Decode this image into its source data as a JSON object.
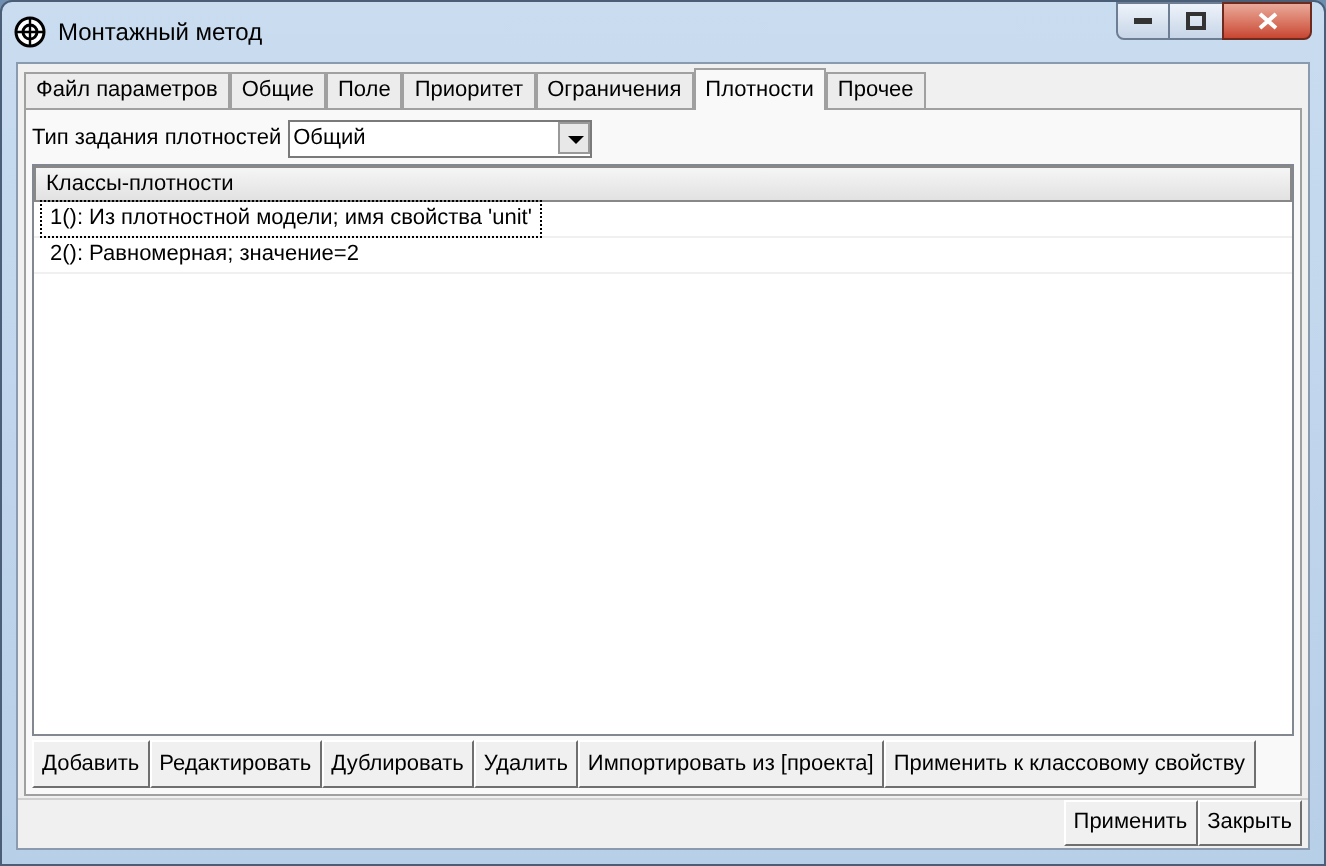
{
  "window": {
    "title": "Монтажный метод"
  },
  "tabs": [
    {
      "label": "Файл параметров",
      "selected": false
    },
    {
      "label": "Общие",
      "selected": false
    },
    {
      "label": "Поле",
      "selected": false
    },
    {
      "label": "Приоритет",
      "selected": false
    },
    {
      "label": "Ограничения",
      "selected": false
    },
    {
      "label": "Плотности",
      "selected": true
    },
    {
      "label": "Прочее",
      "selected": false
    }
  ],
  "density_type": {
    "label": "Тип задания плотностей",
    "value": "Общий"
  },
  "table": {
    "columns": [
      "Классы-плотности"
    ],
    "rows": [
      {
        "text": "1(): Из плотностной модели; имя свойства 'unit'",
        "selected": true
      },
      {
        "text": "2(): Равномерная; значение=2",
        "selected": false
      }
    ]
  },
  "buttons": [
    "Добавить",
    "Редактировать",
    "Дублировать",
    "Удалить",
    "Импортировать из [проекта]",
    "Применить к классовому свойству"
  ],
  "footer_buttons": [
    "Применить",
    "Закрыть"
  ]
}
